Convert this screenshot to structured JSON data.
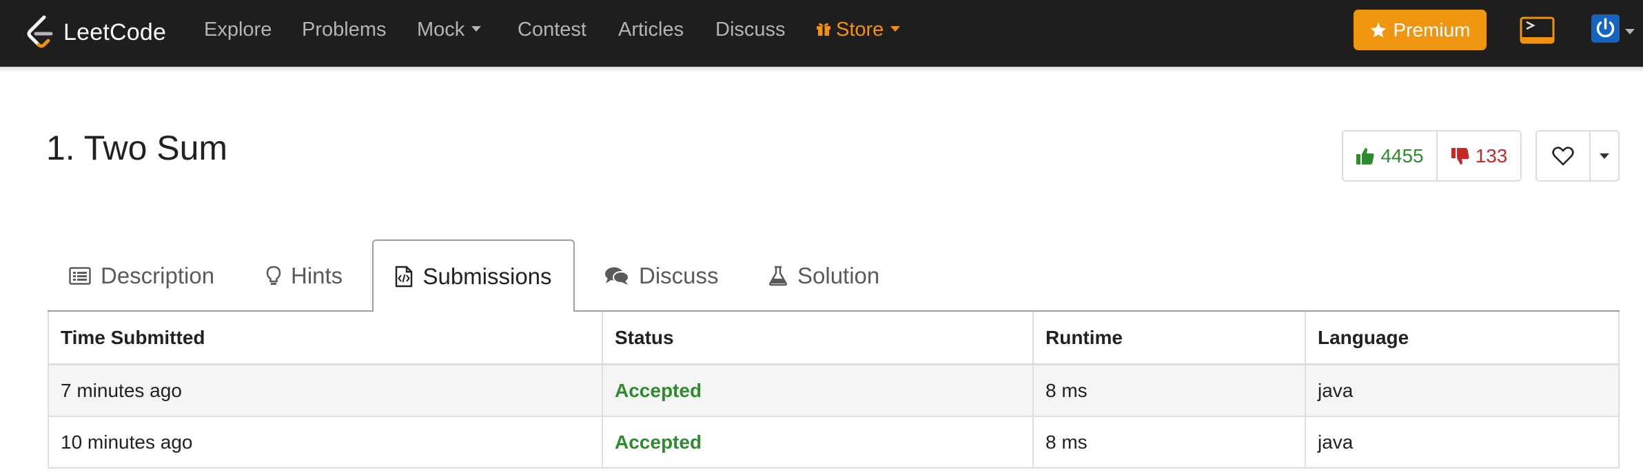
{
  "navbar": {
    "logo_text": "LeetCode",
    "items": [
      {
        "label": "Explore"
      },
      {
        "label": "Problems"
      },
      {
        "label": "Mock"
      },
      {
        "label": "Contest"
      },
      {
        "label": "Articles"
      },
      {
        "label": "Discuss"
      },
      {
        "label": "Store"
      }
    ],
    "premium_label": "Premium",
    "colors": {
      "background": "#1e1e1e",
      "accent": "#f0920e",
      "premium": "#f0960e",
      "text": "#b4b4b4"
    },
    "icons": [
      "leetcode-logo-icon",
      "gift-icon",
      "star-icon",
      "console-icon",
      "power-icon"
    ]
  },
  "problem": {
    "title": "1. Two Sum",
    "likes": "4455",
    "dislikes": "133",
    "icons": [
      "thumbs-up-icon",
      "thumbs-down-icon",
      "heart-icon"
    ]
  },
  "tabs": [
    {
      "label": "Description",
      "icon": "list-icon"
    },
    {
      "label": "Hints",
      "icon": "lightbulb-icon"
    },
    {
      "label": "Submissions",
      "icon": "code-file-icon",
      "active": true
    },
    {
      "label": "Discuss",
      "icon": "comments-icon"
    },
    {
      "label": "Solution",
      "icon": "flask-icon"
    }
  ],
  "submissions": {
    "columns": [
      "Time Submitted",
      "Status",
      "Runtime",
      "Language"
    ],
    "rows": [
      {
        "time": "7 minutes ago",
        "status": "Accepted",
        "runtime": "8 ms",
        "language": "java"
      },
      {
        "time": "10 minutes ago",
        "status": "Accepted",
        "runtime": "8 ms",
        "language": "java"
      }
    ],
    "colors": {
      "accepted": "#2e8b2e",
      "like": "#2e8b2e",
      "dislike": "#c62828"
    }
  }
}
